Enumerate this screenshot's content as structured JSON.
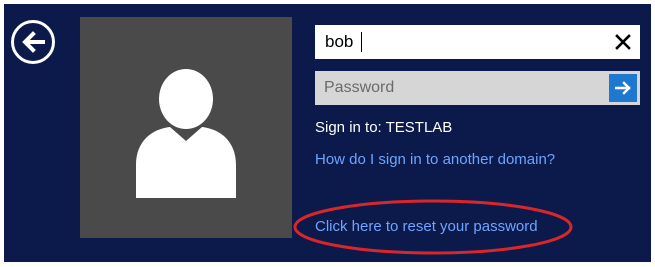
{
  "login": {
    "username_value": "bob",
    "password_placeholder": "Password",
    "sign_in_to_label": "Sign in to: TESTLAB",
    "other_domain_link": "How do I sign in to another domain?",
    "reset_password_link": "Click here to reset your password"
  },
  "icons": {
    "back": "back-arrow-icon",
    "clear": "close-icon",
    "submit": "arrow-right-icon",
    "avatar": "user-silhouette-icon"
  },
  "colors": {
    "background": "#0b1a4a",
    "avatar_tile": "#4a4a4a",
    "submit_button": "#1f78cf",
    "link": "#6ea4ff",
    "highlight": "#d9262b"
  }
}
